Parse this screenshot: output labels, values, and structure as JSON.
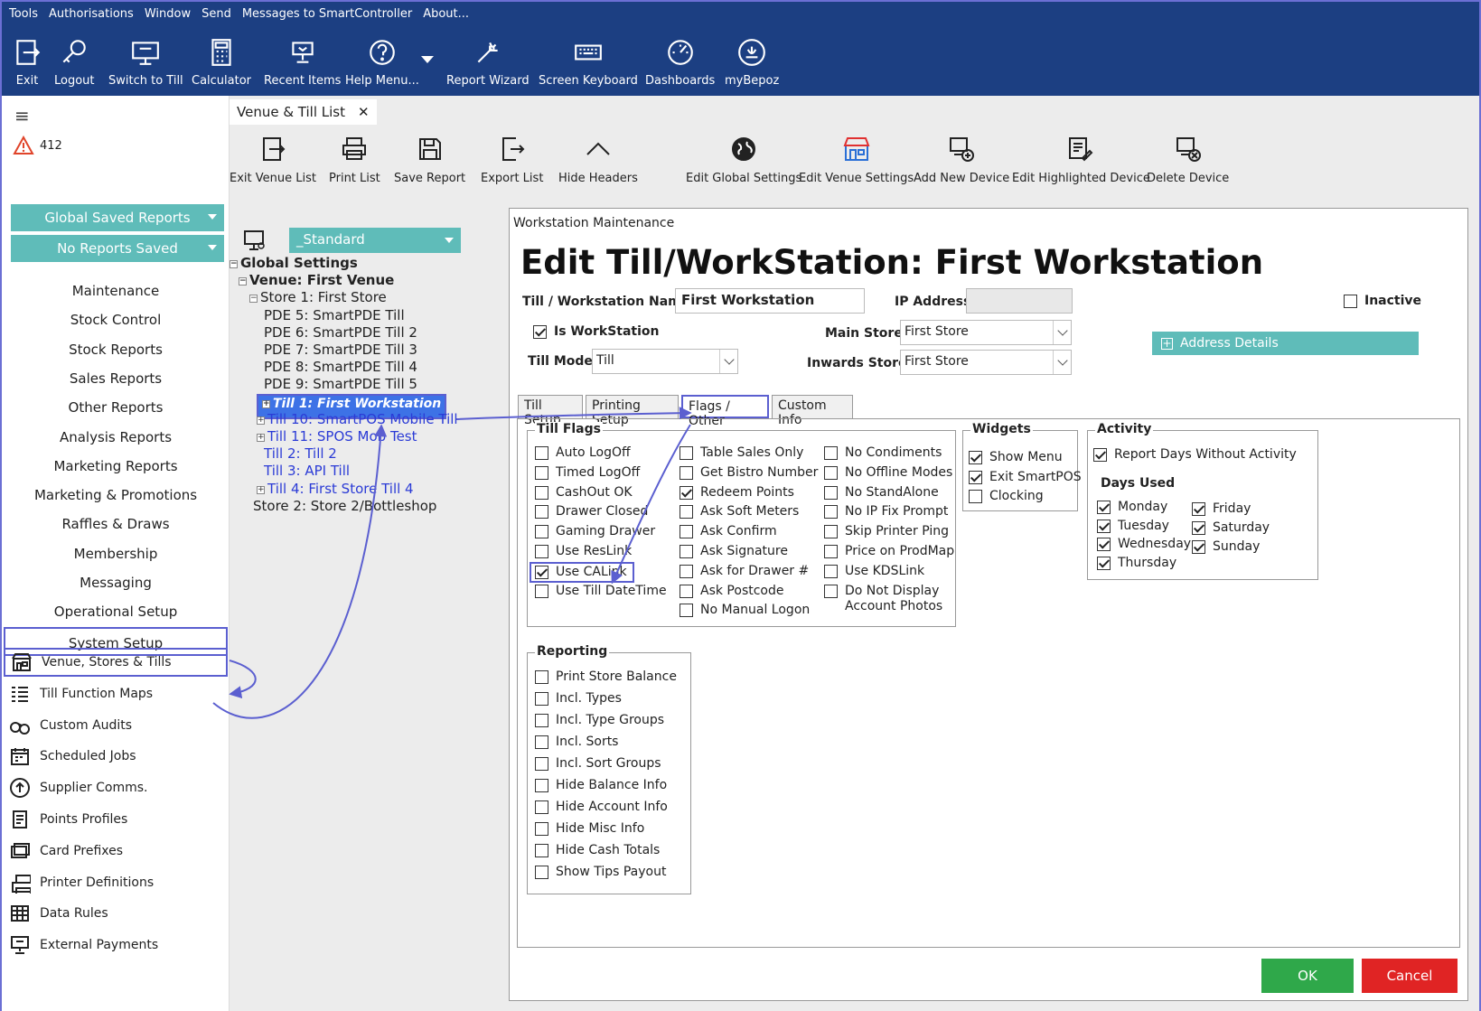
{
  "menubar": [
    "Tools",
    "Authorisations",
    "Window",
    "Send",
    "Messages to SmartController",
    "About..."
  ],
  "main_toolbar": [
    {
      "label": "Exit",
      "icon": "exit-icon"
    },
    {
      "label": "Logout",
      "icon": "key-icon"
    },
    {
      "label": "Switch to Till",
      "icon": "till-icon"
    },
    {
      "label": "Calculator",
      "icon": "calculator-icon"
    },
    {
      "label": "Recent Items",
      "icon": "recent-items-icon"
    },
    {
      "label": "Help Menu...",
      "icon": "help-icon"
    },
    {
      "label": "Report Wizard",
      "icon": "wand-icon"
    },
    {
      "label": "Screen Keyboard",
      "icon": "keyboard-icon"
    },
    {
      "label": "Dashboards",
      "icon": "dashboard-icon"
    },
    {
      "label": "myBepoz",
      "icon": "mybepoz-icon"
    }
  ],
  "sidebar": {
    "alert_count": "412",
    "global_saved_reports": "Global Saved Reports",
    "no_reports_saved": "No Reports Saved",
    "text_items": [
      "Maintenance",
      "Stock Control",
      "Stock Reports",
      "Sales Reports",
      "Other Reports",
      "Analysis Reports",
      "Marketing Reports",
      "Marketing & Promotions",
      "Raffles & Draws",
      "Membership",
      "Messaging",
      "Operational Setup",
      "System Setup"
    ],
    "icon_items": [
      {
        "label": "Venue, Stores & Tills",
        "icon": "venue-icon"
      },
      {
        "label": "Till Function Maps",
        "icon": "grid-icon"
      },
      {
        "label": "Custom Audits",
        "icon": "handcuffs-icon"
      },
      {
        "label": "Scheduled Jobs",
        "icon": "calendar-icon"
      },
      {
        "label": "Supplier Comms.",
        "icon": "upload-icon"
      },
      {
        "label": "Points Profiles",
        "icon": "document-icon"
      },
      {
        "label": "Card Prefixes",
        "icon": "card-icon"
      },
      {
        "label": "Printer Definitions",
        "icon": "printer-icon"
      },
      {
        "label": "Data Rules",
        "icon": "table-icon"
      },
      {
        "label": "External Payments",
        "icon": "payments-icon"
      }
    ]
  },
  "venue_tab": {
    "title": "Venue & Till List",
    "close": "✕"
  },
  "venue_toolbar": [
    {
      "label": "Exit Venue List",
      "icon": "exit-icon"
    },
    {
      "label": "Print List",
      "icon": "printer-icon"
    },
    {
      "label": "Save Report",
      "icon": "save-icon"
    },
    {
      "label": "Export List",
      "icon": "export-icon"
    },
    {
      "label": "Hide Headers",
      "icon": "chevron-up-icon"
    },
    {
      "label": "Edit Global Settings",
      "icon": "globe-icon"
    },
    {
      "label": "Edit Venue Settings",
      "icon": "store-icon"
    },
    {
      "label": "Add New Device",
      "icon": "add-device-icon"
    },
    {
      "label": "Edit Highlighted Device",
      "icon": "edit-device-icon"
    },
    {
      "label": "Delete Device",
      "icon": "delete-device-icon"
    }
  ],
  "standard_dropdown": "_Standard",
  "tree": [
    {
      "text": "Global Settings",
      "style": "b",
      "pm": "−"
    },
    {
      "text": "Venue: First Venue",
      "style": "b",
      "pm": "−"
    },
    {
      "text": "Store 1: First Store",
      "style": "",
      "pm": "−"
    },
    {
      "text": "PDE 5: SmartPDE Till",
      "style": "",
      "pm": ""
    },
    {
      "text": "PDE 6: SmartPDE Till 2",
      "style": "",
      "pm": ""
    },
    {
      "text": "PDE 7: SmartPDE Till 3",
      "style": "",
      "pm": ""
    },
    {
      "text": "PDE 8: SmartPDE Till 4",
      "style": "",
      "pm": ""
    },
    {
      "text": "PDE 9: SmartPDE Till 5",
      "style": "",
      "pm": ""
    },
    {
      "text": "Till 1: First Workstation",
      "style": "sel",
      "pm": "+"
    },
    {
      "text": "Till 10: SmartPOS Mobile Till",
      "style": "blue",
      "pm": "+"
    },
    {
      "text": "Till 11: SPOS Mob Test",
      "style": "blue",
      "pm": "+"
    },
    {
      "text": "Till 2: Till 2",
      "style": "blue",
      "pm": ""
    },
    {
      "text": "Till 3: API Till",
      "style": "blue",
      "pm": ""
    },
    {
      "text": "Till 4: First Store Till 4",
      "style": "blue",
      "pm": "+"
    },
    {
      "text": "Store 2: Store 2/Bottleshop",
      "style": "",
      "pm": ""
    }
  ],
  "dialog": {
    "window_title": "Workstation Maintenance",
    "heading": "Edit Till/WorkStation: First Workstation",
    "name_label": "Till / Workstation Name:",
    "name_value": "First Workstation",
    "ip_label": "IP Address:",
    "ip_value": "",
    "inactive_label": "Inactive",
    "is_workstation_label": "Is WorkStation",
    "main_store_label": "Main Store:",
    "main_store_value": "First Store",
    "address_details": "Address Details",
    "till_mode_label": "Till Mode:",
    "till_mode_value": "Till",
    "inwards_store_label": "Inwards Store:",
    "inwards_store_value": "First Store",
    "tabs": [
      "Till Setup",
      "Printing Setup",
      "Flags / Other",
      "Custom Info"
    ],
    "till_flags_title": "Till Flags",
    "till_flags_col1": [
      {
        "label": "Auto LogOff",
        "checked": false
      },
      {
        "label": "Timed LogOff",
        "checked": false
      },
      {
        "label": "CashOut OK",
        "checked": false
      },
      {
        "label": "Drawer Closed",
        "checked": false
      },
      {
        "label": "Gaming Drawer",
        "checked": false
      },
      {
        "label": "Use ResLink",
        "checked": false
      },
      {
        "label": "Use CALink",
        "checked": true
      },
      {
        "label": "Use Till DateTime",
        "checked": false
      }
    ],
    "till_flags_col2": [
      {
        "label": "Table Sales Only",
        "checked": false
      },
      {
        "label": "Get Bistro Number",
        "checked": false
      },
      {
        "label": "Redeem Points",
        "checked": true
      },
      {
        "label": "Ask Soft Meters",
        "checked": false
      },
      {
        "label": "Ask Confirm",
        "checked": false
      },
      {
        "label": "Ask Signature",
        "checked": false
      },
      {
        "label": "Ask for Drawer #",
        "checked": false
      },
      {
        "label": "Ask Postcode",
        "checked": false
      },
      {
        "label": "No Manual Logon",
        "checked": false
      }
    ],
    "till_flags_col3": [
      {
        "label": "No Condiments",
        "checked": false
      },
      {
        "label": "No Offline Modes",
        "checked": false
      },
      {
        "label": "No StandAlone",
        "checked": false
      },
      {
        "label": "No IP Fix Prompt",
        "checked": false
      },
      {
        "label": "Skip Printer Ping",
        "checked": false
      },
      {
        "label": "Price on ProdMap",
        "checked": false
      },
      {
        "label": "Use KDSLink",
        "checked": false
      },
      {
        "label": "Do Not Display\nAccount Photos",
        "checked": false
      }
    ],
    "widgets_title": "Widgets",
    "widgets": [
      {
        "label": "Show Menu",
        "checked": true
      },
      {
        "label": "Exit SmartPOS",
        "checked": true
      },
      {
        "label": "Clocking",
        "checked": false
      }
    ],
    "activity_title": "Activity",
    "report_days_without_activity": "Report Days Without Activity",
    "days_used_title": "Days Used",
    "days_col1": [
      {
        "label": "Monday",
        "checked": true
      },
      {
        "label": "Tuesday",
        "checked": true
      },
      {
        "label": "Wednesday",
        "checked": true
      },
      {
        "label": "Thursday",
        "checked": true
      }
    ],
    "days_col2": [
      {
        "label": "Friday",
        "checked": true
      },
      {
        "label": "Saturday",
        "checked": true
      },
      {
        "label": "Sunday",
        "checked": true
      }
    ],
    "reporting_title": "Reporting",
    "reporting": [
      {
        "label": "Print Store Balance",
        "checked": false
      },
      {
        "label": "Incl. Types",
        "checked": false
      },
      {
        "label": "Incl. Type Groups",
        "checked": false
      },
      {
        "label": "Incl. Sorts",
        "checked": false
      },
      {
        "label": "Incl. Sort Groups",
        "checked": false
      },
      {
        "label": "Hide Balance Info",
        "checked": false
      },
      {
        "label": "Hide Account Info",
        "checked": false
      },
      {
        "label": "Hide Misc Info",
        "checked": false
      },
      {
        "label": "Hide Cash Totals",
        "checked": false
      },
      {
        "label": "Show Tips Payout",
        "checked": false
      }
    ],
    "ok_label": "OK",
    "cancel_label": "Cancel"
  },
  "colors": {
    "topbar": "#1c3f82",
    "teal": "#5fbcb9",
    "highlight": "#5b5fd0",
    "ok": "#2fa84a",
    "cancel": "#e02424"
  }
}
